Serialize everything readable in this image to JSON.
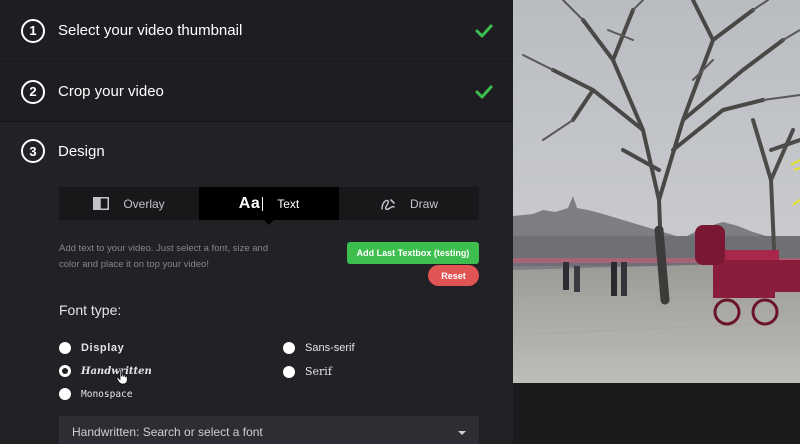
{
  "steps": [
    {
      "number": "1",
      "title": "Select your video thumbnail",
      "completed": true
    },
    {
      "number": "2",
      "title": "Crop your video",
      "completed": true
    },
    {
      "number": "3",
      "title": "Design",
      "completed": false
    }
  ],
  "design": {
    "tabs": [
      {
        "label": "Overlay",
        "icon": "overlay-icon",
        "active": false
      },
      {
        "label": "Text",
        "icon": "text-aa-icon",
        "icon_text": "Aa",
        "active": true
      },
      {
        "label": "Draw",
        "icon": "draw-icon",
        "active": false
      }
    ],
    "help_text": "Add text to your video. Just select a font, size and color and place it on top your video!",
    "add_button_label": "Add Last Textbox (testing)",
    "reset_button_label": "Reset",
    "font_type_label": "Font type:",
    "font_options": [
      {
        "label": "Display",
        "selected": false
      },
      {
        "label": "Handwritten",
        "selected": true
      },
      {
        "label": "Monospace",
        "selected": false
      },
      {
        "label": "Sans-serif",
        "selected": false
      },
      {
        "label": "Serif",
        "selected": false
      }
    ],
    "font_select_value": "Handwritten: Search or select a font"
  },
  "colors": {
    "accent_green": "#3cbf4e",
    "reset_red": "#e05454",
    "check_green": "#3cbf4e"
  },
  "preview": {
    "description_icon": "video-frame"
  }
}
